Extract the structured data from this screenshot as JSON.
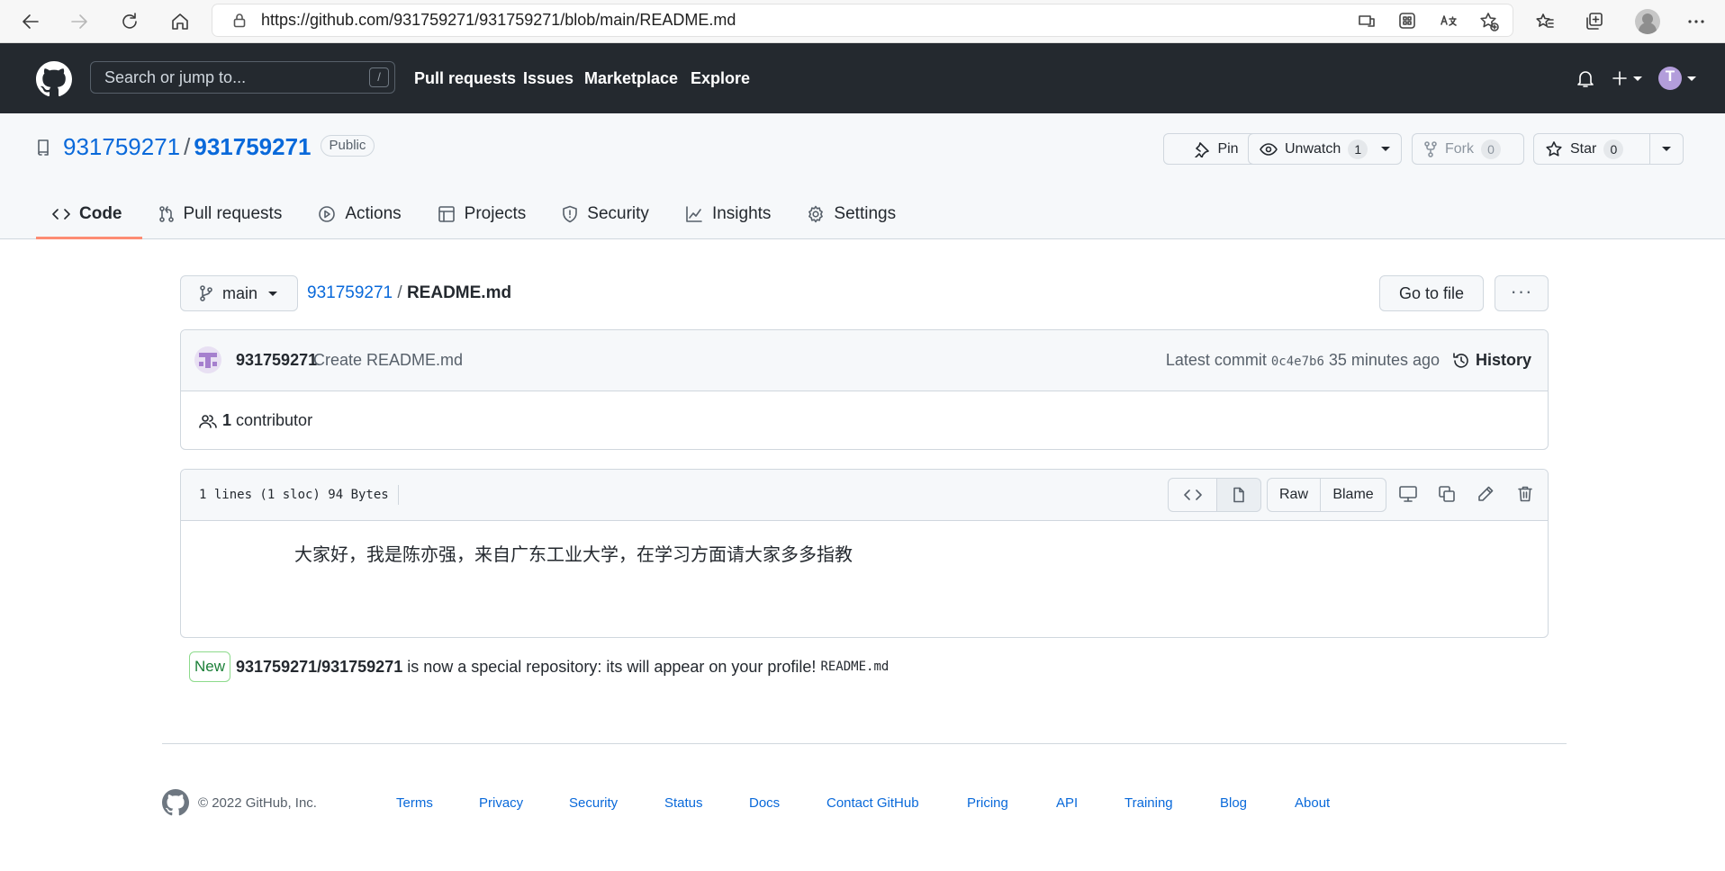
{
  "browser": {
    "url": "https://github.com/931759271/931759271/blob/main/README.md",
    "icons": [
      "back-icon",
      "forward-icon",
      "refresh-icon",
      "home-icon",
      "lock-icon",
      "app-available-icon",
      "extensions-icon",
      "read-aloud-icon",
      "favorite-add-icon",
      "favorites-icon",
      "collections-icon",
      "profile-icon",
      "more-icon"
    ]
  },
  "header": {
    "search_placeholder": "Search or jump to...",
    "search_key": "/",
    "nav": [
      "Pull requests",
      "Issues",
      "Marketplace",
      "Explore"
    ]
  },
  "repo": {
    "owner": "931759271",
    "separator": "/",
    "name": "931759271",
    "visibility": "Public",
    "pin_label": "Pin",
    "watch_label": "Unwatch",
    "watch_count": "1",
    "fork_label": "Fork",
    "fork_count": "0",
    "star_label": "Star",
    "star_count": "0",
    "tabs": [
      {
        "label": "Code",
        "selected": true
      },
      {
        "label": "Pull requests"
      },
      {
        "label": "Actions"
      },
      {
        "label": "Projects"
      },
      {
        "label": "Security"
      },
      {
        "label": "Insights"
      },
      {
        "label": "Settings"
      }
    ]
  },
  "file_nav": {
    "branch": "main",
    "crumb_repo": "931759271",
    "crumb_sep": "/",
    "crumb_file": "README.md",
    "goto_label": "Go to file",
    "more_label": "···"
  },
  "commit": {
    "author": "931759271",
    "message": "Create README.md",
    "latest_label": "Latest commit",
    "sha": "0c4e7b6",
    "time": "35 minutes ago",
    "history_label": "History",
    "contributors_count": "1",
    "contributors_label": "contributor"
  },
  "file": {
    "info": "1 lines (1 sloc)   94 Bytes",
    "raw_label": "Raw",
    "blame_label": "Blame",
    "content": "大家好，我是陈亦强，来自广东工业大学，在学习方面请大家多多指教"
  },
  "notice": {
    "badge": "New",
    "repo": "931759271/931759271",
    "text": "is now a special repository: its will appear on your profile!",
    "file": "README.md"
  },
  "footer": {
    "copyright": "© 2022 GitHub, Inc.",
    "links": [
      "Terms",
      "Privacy",
      "Security",
      "Status",
      "Docs",
      "Contact GitHub",
      "Pricing",
      "API",
      "Training",
      "Blog",
      "About"
    ]
  },
  "colors": {
    "header_bg": "#24292f",
    "link": "#0969da",
    "tab_underline": "#fd8c73",
    "new_badge": "#1a7f37"
  }
}
